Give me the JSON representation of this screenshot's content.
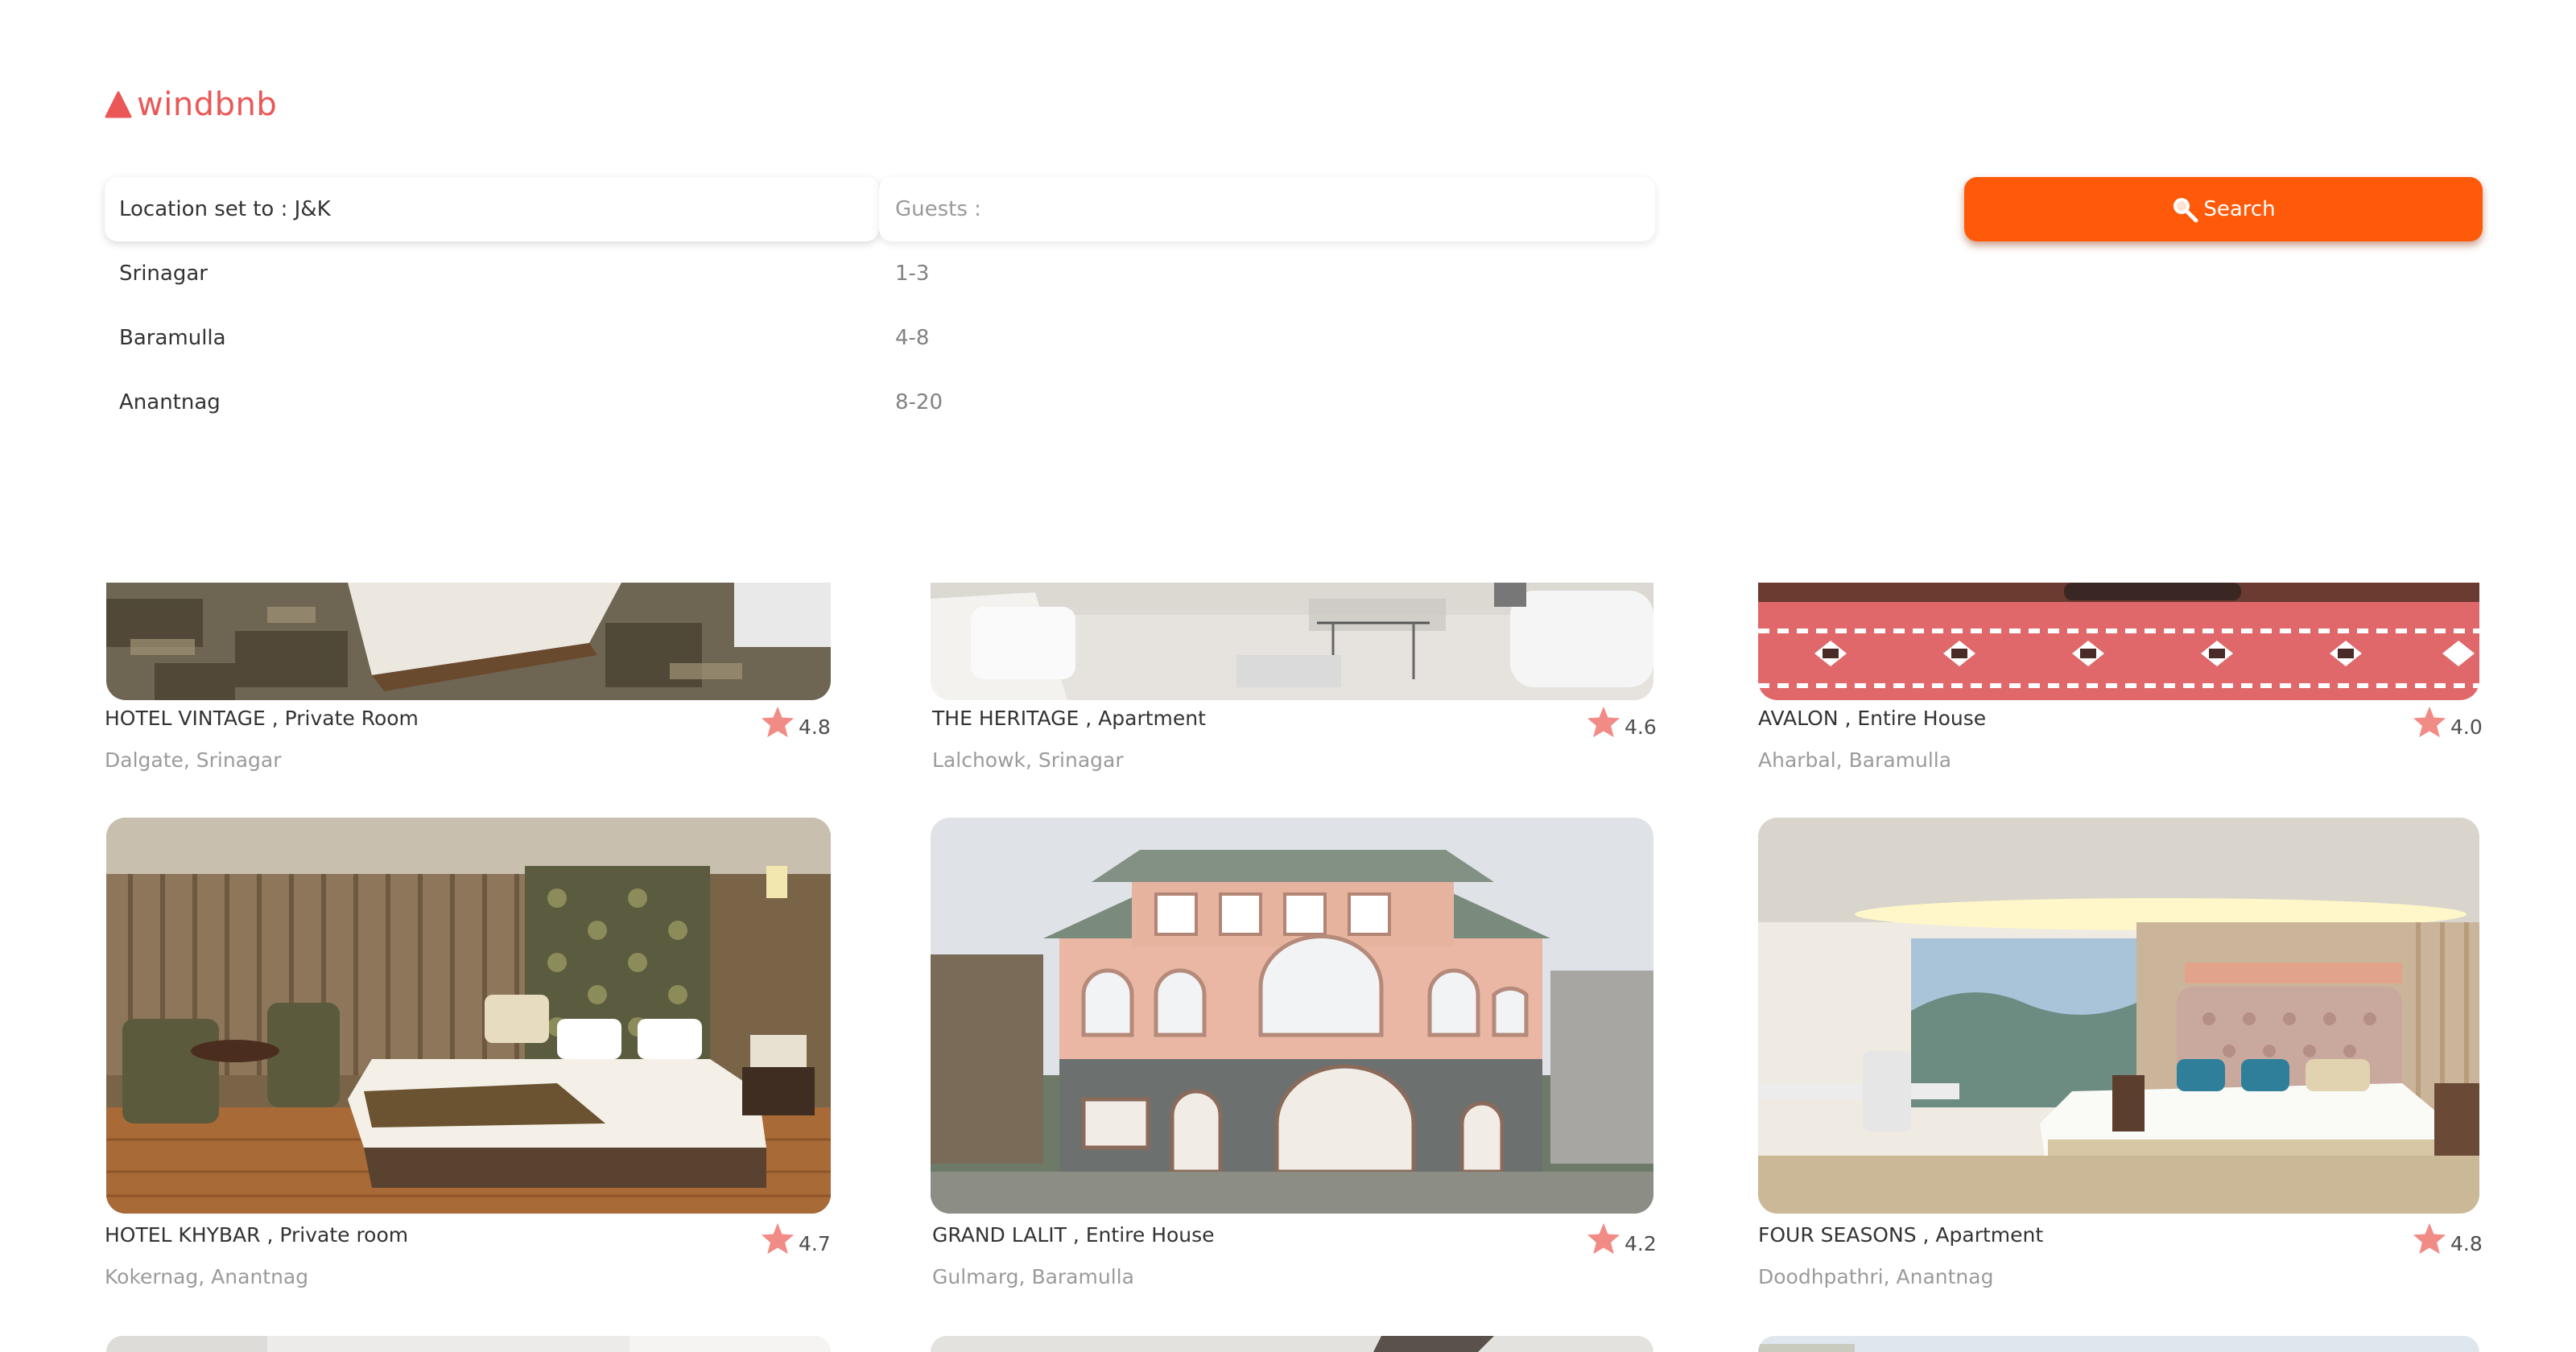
{
  "brand": {
    "name": "windbnb",
    "color": "#eb5757"
  },
  "search": {
    "location_label": "Location set to : J&K",
    "guests_label": "Guests :",
    "button_label": "Search",
    "button_color": "#ff5a0a"
  },
  "locations": [
    "Srinagar",
    "Baramulla",
    "Anantnag"
  ],
  "guest_ranges": [
    "1-3",
    "4-8",
    "8-20"
  ],
  "listings": [
    {
      "title": "HOTEL VINTAGE , Private Room",
      "location": "Dalgate, Srinagar",
      "rating": "4.8"
    },
    {
      "title": "THE HERITAGE , Apartment",
      "location": "Lalchowk, Srinagar",
      "rating": "4.6"
    },
    {
      "title": "AVALON , Entire House",
      "location": "Aharbal, Baramulla",
      "rating": "4.0"
    },
    {
      "title": "HOTEL KHYBAR , Private room",
      "location": "Kokernag, Anantnag",
      "rating": "4.7"
    },
    {
      "title": "GRAND LALIT , Entire House",
      "location": "Gulmarg, Baramulla",
      "rating": "4.2"
    },
    {
      "title": "FOUR SEASONS , Apartment",
      "location": "Doodhpathri, Anantnag",
      "rating": "4.8"
    }
  ],
  "star_color": "#f18b86"
}
